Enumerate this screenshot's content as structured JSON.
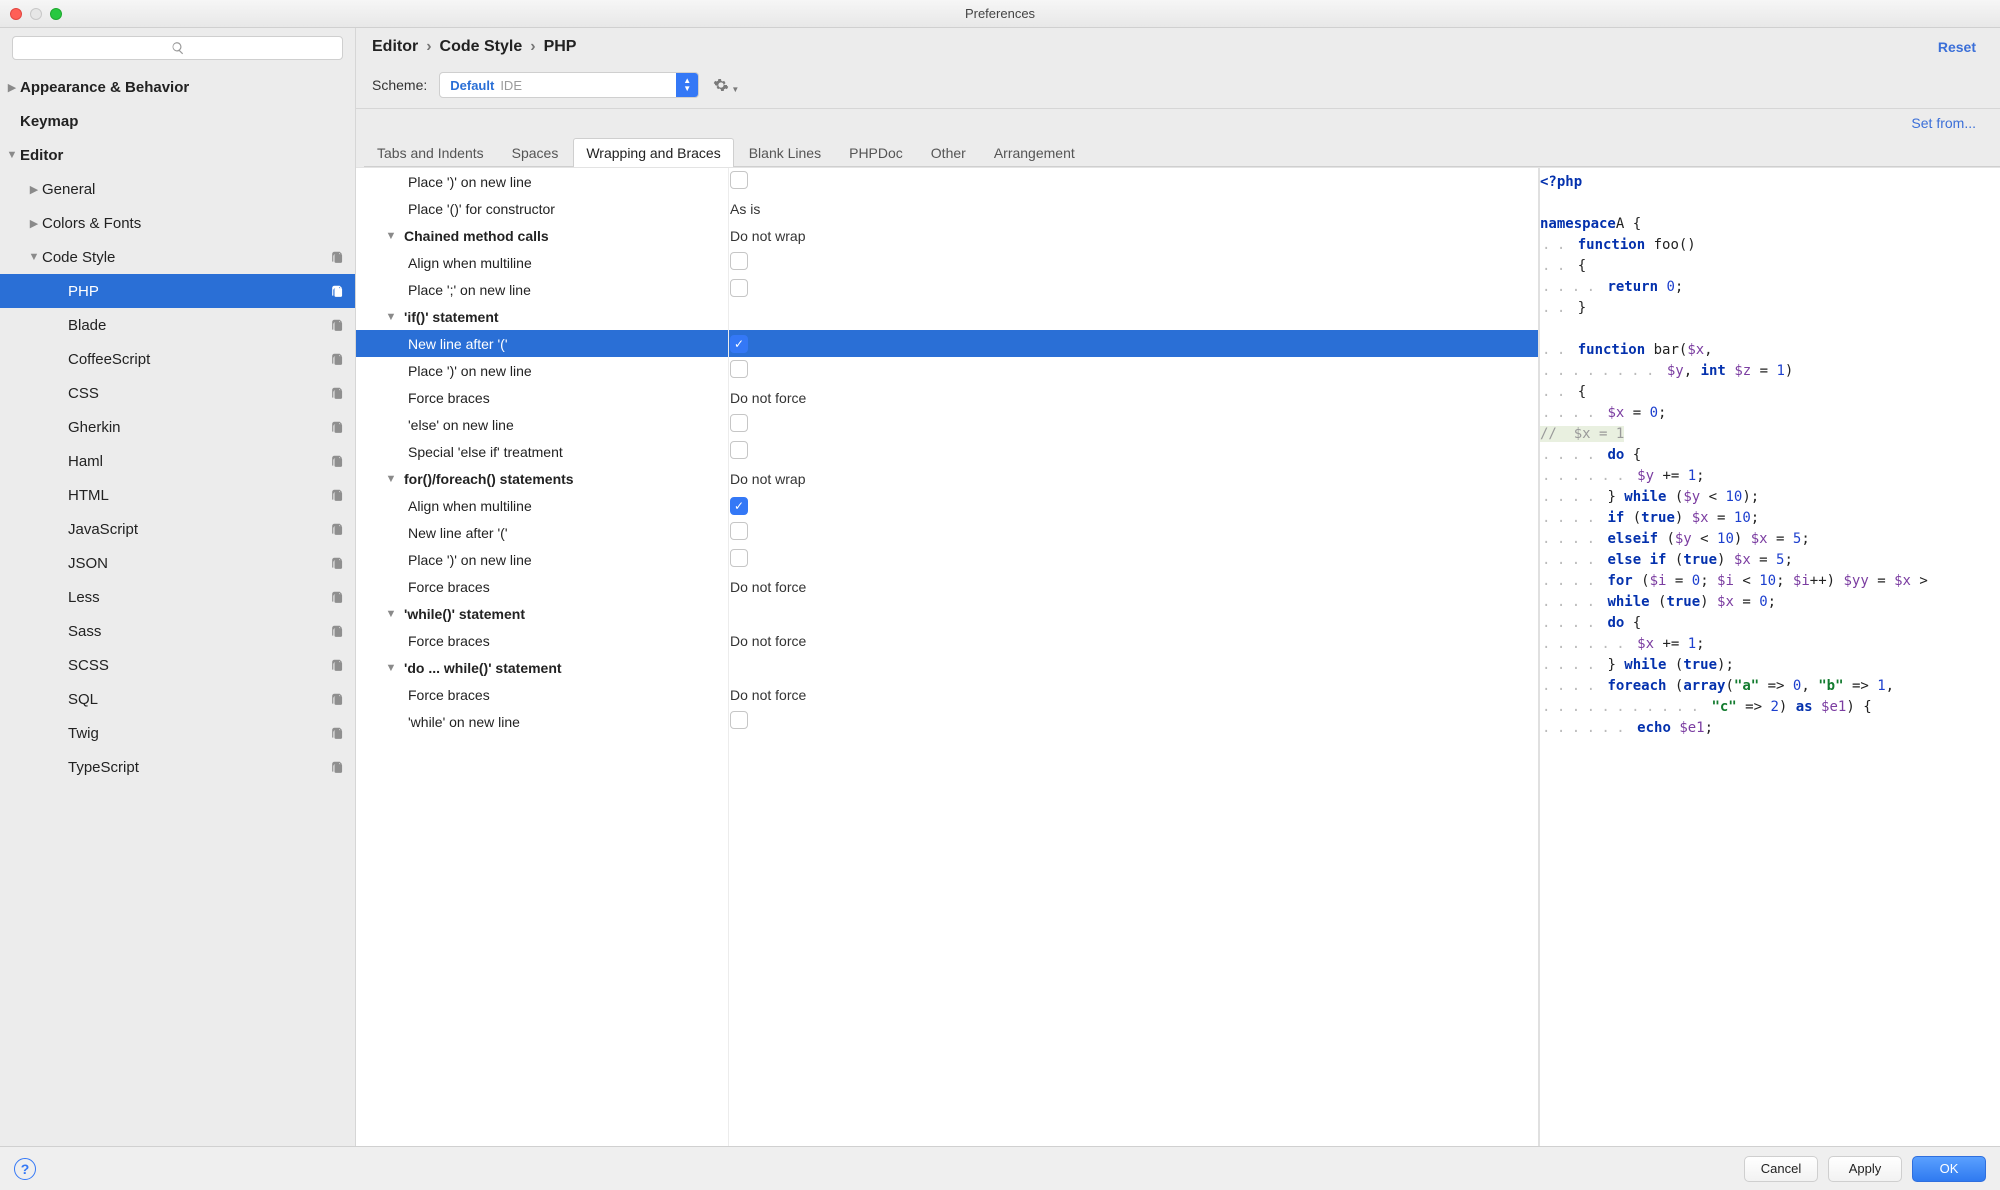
{
  "window": {
    "title": "Preferences"
  },
  "header": {
    "breadcrumb": [
      "Editor",
      "Code Style",
      "PHP"
    ],
    "reset_label": "Reset",
    "scheme_label": "Scheme:",
    "scheme_primary": "Default",
    "scheme_secondary": "IDE",
    "set_from_label": "Set from..."
  },
  "sidebar": {
    "items": [
      {
        "label": "Appearance & Behavior",
        "depth": 0,
        "twisty": "right"
      },
      {
        "label": "Keymap",
        "depth": 0
      },
      {
        "label": "Editor",
        "depth": 0,
        "twisty": "down"
      },
      {
        "label": "General",
        "depth": 1,
        "twisty": "right"
      },
      {
        "label": "Colors & Fonts",
        "depth": 1,
        "twisty": "right"
      },
      {
        "label": "Code Style",
        "depth": 1,
        "twisty": "down",
        "action": true
      },
      {
        "label": "PHP",
        "depth": 2,
        "action": true,
        "selected": true
      },
      {
        "label": "Blade",
        "depth": 2,
        "action": true
      },
      {
        "label": "CoffeeScript",
        "depth": 2,
        "action": true
      },
      {
        "label": "CSS",
        "depth": 2,
        "action": true
      },
      {
        "label": "Gherkin",
        "depth": 2,
        "action": true
      },
      {
        "label": "Haml",
        "depth": 2,
        "action": true
      },
      {
        "label": "HTML",
        "depth": 2,
        "action": true
      },
      {
        "label": "JavaScript",
        "depth": 2,
        "action": true
      },
      {
        "label": "JSON",
        "depth": 2,
        "action": true
      },
      {
        "label": "Less",
        "depth": 2,
        "action": true
      },
      {
        "label": "Sass",
        "depth": 2,
        "action": true
      },
      {
        "label": "SCSS",
        "depth": 2,
        "action": true
      },
      {
        "label": "SQL",
        "depth": 2,
        "action": true
      },
      {
        "label": "Twig",
        "depth": 2,
        "action": true
      },
      {
        "label": "TypeScript",
        "depth": 2,
        "action": true
      }
    ]
  },
  "tabs": [
    {
      "label": "Tabs and Indents"
    },
    {
      "label": "Spaces"
    },
    {
      "label": "Wrapping and Braces",
      "active": true
    },
    {
      "label": "Blank Lines"
    },
    {
      "label": "PHPDoc"
    },
    {
      "label": "Other"
    },
    {
      "label": "Arrangement"
    }
  ],
  "options": [
    {
      "label": "Place ')' on new line",
      "indent": 2,
      "ctl": "checkbox",
      "checked": false
    },
    {
      "label": "Place '()' for constructor",
      "indent": 2,
      "ctl": "text",
      "value": "As is"
    },
    {
      "label": "Chained method calls",
      "indent": 1,
      "header": true,
      "twisty": "down",
      "ctl": "text",
      "value": "Do not wrap"
    },
    {
      "label": "Align when multiline",
      "indent": 2,
      "ctl": "checkbox",
      "checked": false
    },
    {
      "label": "Place ';' on new line",
      "indent": 2,
      "ctl": "checkbox",
      "checked": false
    },
    {
      "label": "'if()' statement",
      "indent": 1,
      "header": true,
      "twisty": "down"
    },
    {
      "label": "New line after '('",
      "indent": 2,
      "ctl": "checkbox",
      "checked": true,
      "selected": true
    },
    {
      "label": "Place ')' on new line",
      "indent": 2,
      "ctl": "checkbox",
      "checked": false
    },
    {
      "label": "Force braces",
      "indent": 2,
      "ctl": "text",
      "value": "Do not force"
    },
    {
      "label": "'else' on new line",
      "indent": 2,
      "ctl": "checkbox",
      "checked": false
    },
    {
      "label": "Special 'else if' treatment",
      "indent": 2,
      "ctl": "checkbox",
      "checked": false
    },
    {
      "label": "for()/foreach() statements",
      "indent": 1,
      "header": true,
      "twisty": "down",
      "ctl": "text",
      "value": "Do not wrap"
    },
    {
      "label": "Align when multiline",
      "indent": 2,
      "ctl": "checkbox",
      "checked": true
    },
    {
      "label": "New line after '('",
      "indent": 2,
      "ctl": "checkbox",
      "checked": false
    },
    {
      "label": "Place ')' on new line",
      "indent": 2,
      "ctl": "checkbox",
      "checked": false
    },
    {
      "label": "Force braces",
      "indent": 2,
      "ctl": "text",
      "value": "Do not force"
    },
    {
      "label": "'while()' statement",
      "indent": 1,
      "header": true,
      "twisty": "down"
    },
    {
      "label": "Force braces",
      "indent": 2,
      "ctl": "text",
      "value": "Do not force"
    },
    {
      "label": "'do ... while()' statement",
      "indent": 1,
      "header": true,
      "twisty": "down"
    },
    {
      "label": "Force braces",
      "indent": 2,
      "ctl": "text",
      "value": "Do not force"
    },
    {
      "label": "'while' on new line",
      "indent": 2,
      "ctl": "checkbox",
      "checked": false
    }
  ],
  "preview_lines": [
    [
      [
        "kw",
        "<?php"
      ]
    ],
    [],
    [
      [
        "kw",
        "namespace"
      ],
      [
        "",
        ""
      ],
      [
        "",
        "A {"
      ]
    ],
    [
      [
        "",
        "    "
      ],
      [
        "kw",
        "function"
      ],
      [
        "",
        " foo()"
      ]
    ],
    [
      [
        "",
        "    {"
      ]
    ],
    [
      [
        "",
        "        "
      ],
      [
        "kw",
        "return"
      ],
      [
        "",
        " "
      ],
      [
        "num",
        "0"
      ],
      [
        "",
        ";"
      ]
    ],
    [
      [
        "",
        "    }"
      ]
    ],
    [],
    [
      [
        "",
        "    "
      ],
      [
        "kw",
        "function"
      ],
      [
        "",
        " bar("
      ],
      [
        "var",
        "$x"
      ],
      [
        "",
        ","
      ]
    ],
    [
      [
        "",
        "                 "
      ],
      [
        "var",
        "$y"
      ],
      [
        "",
        ", "
      ],
      [
        "kw",
        "int"
      ],
      [
        "",
        " "
      ],
      [
        "var",
        "$z"
      ],
      [
        "",
        " = "
      ],
      [
        "num",
        "1"
      ],
      [
        "",
        ")"
      ]
    ],
    [
      [
        "",
        "    {"
      ]
    ],
    [
      [
        "",
        "        "
      ],
      [
        "var",
        "$x"
      ],
      [
        "",
        " = "
      ],
      [
        "num",
        "0"
      ],
      [
        "",
        ";"
      ]
    ],
    [
      [
        "cmt",
        "//  $x = 1"
      ]
    ],
    [
      [
        "",
        "        "
      ],
      [
        "kw",
        "do"
      ],
      [
        "",
        " {"
      ]
    ],
    [
      [
        "",
        "            "
      ],
      [
        "var",
        "$y"
      ],
      [
        "",
        " += "
      ],
      [
        "num",
        "1"
      ],
      [
        "",
        ";"
      ]
    ],
    [
      [
        "",
        "        } "
      ],
      [
        "kw",
        "while"
      ],
      [
        "",
        " ("
      ],
      [
        "var",
        "$y"
      ],
      [
        "",
        " < "
      ],
      [
        "num",
        "10"
      ],
      [
        "",
        ");"
      ]
    ],
    [
      [
        "",
        "        "
      ],
      [
        "kw",
        "if"
      ],
      [
        "",
        " ("
      ],
      [
        "kw",
        "true"
      ],
      [
        "",
        ") "
      ],
      [
        "var",
        "$x"
      ],
      [
        "",
        " = "
      ],
      [
        "num",
        "10"
      ],
      [
        "",
        ";"
      ]
    ],
    [
      [
        "",
        "        "
      ],
      [
        "kw",
        "elseif"
      ],
      [
        "",
        " ("
      ],
      [
        "var",
        "$y"
      ],
      [
        "",
        " < "
      ],
      [
        "num",
        "10"
      ],
      [
        "",
        ") "
      ],
      [
        "var",
        "$x"
      ],
      [
        "",
        " = "
      ],
      [
        "num",
        "5"
      ],
      [
        "",
        ";"
      ]
    ],
    [
      [
        "",
        "        "
      ],
      [
        "kw",
        "else if"
      ],
      [
        "",
        " ("
      ],
      [
        "kw",
        "true"
      ],
      [
        "",
        ") "
      ],
      [
        "var",
        "$x"
      ],
      [
        "",
        " = "
      ],
      [
        "num",
        "5"
      ],
      [
        "",
        ";"
      ]
    ],
    [
      [
        "",
        "        "
      ],
      [
        "kw",
        "for"
      ],
      [
        "",
        " ("
      ],
      [
        "var",
        "$i"
      ],
      [
        "",
        " = "
      ],
      [
        "num",
        "0"
      ],
      [
        "",
        "; "
      ],
      [
        "var",
        "$i"
      ],
      [
        "",
        " < "
      ],
      [
        "num",
        "10"
      ],
      [
        "",
        "; "
      ],
      [
        "var",
        "$i"
      ],
      [
        "",
        "++) "
      ],
      [
        "var",
        "$yy"
      ],
      [
        "",
        " = "
      ],
      [
        "var",
        "$x"
      ],
      [
        "",
        " > "
      ]
    ],
    [
      [
        "",
        "        "
      ],
      [
        "kw",
        "while"
      ],
      [
        "",
        " ("
      ],
      [
        "kw",
        "true"
      ],
      [
        "",
        ") "
      ],
      [
        "var",
        "$x"
      ],
      [
        "",
        " = "
      ],
      [
        "num",
        "0"
      ],
      [
        "",
        ";"
      ]
    ],
    [
      [
        "",
        "        "
      ],
      [
        "kw",
        "do"
      ],
      [
        "",
        " {"
      ]
    ],
    [
      [
        "",
        "            "
      ],
      [
        "var",
        "$x"
      ],
      [
        "",
        " += "
      ],
      [
        "num",
        "1"
      ],
      [
        "",
        ";"
      ]
    ],
    [
      [
        "",
        "        } "
      ],
      [
        "kw",
        "while"
      ],
      [
        "",
        " ("
      ],
      [
        "kw",
        "true"
      ],
      [
        "",
        ");"
      ]
    ],
    [
      [
        "",
        "        "
      ],
      [
        "kw",
        "foreach"
      ],
      [
        "",
        " ("
      ],
      [
        "kw",
        "array"
      ],
      [
        "",
        "("
      ],
      [
        "str",
        "\"a\""
      ],
      [
        "",
        " => "
      ],
      [
        "num",
        "0"
      ],
      [
        "",
        ", "
      ],
      [
        "str",
        "\"b\""
      ],
      [
        "",
        " => "
      ],
      [
        "num",
        "1"
      ],
      [
        "",
        ","
      ]
    ],
    [
      [
        "",
        "                       "
      ],
      [
        "str",
        "\"c\""
      ],
      [
        "",
        " => "
      ],
      [
        "num",
        "2"
      ],
      [
        "",
        ") "
      ],
      [
        "kw",
        "as"
      ],
      [
        "",
        " "
      ],
      [
        "var",
        "$e1"
      ],
      [
        "",
        ") {"
      ]
    ],
    [
      [
        "",
        "            "
      ],
      [
        "kw",
        "echo"
      ],
      [
        "",
        " "
      ],
      [
        "var",
        "$e1"
      ],
      [
        "",
        ";"
      ]
    ]
  ],
  "footer": {
    "cancel": "Cancel",
    "apply": "Apply",
    "ok": "OK"
  }
}
